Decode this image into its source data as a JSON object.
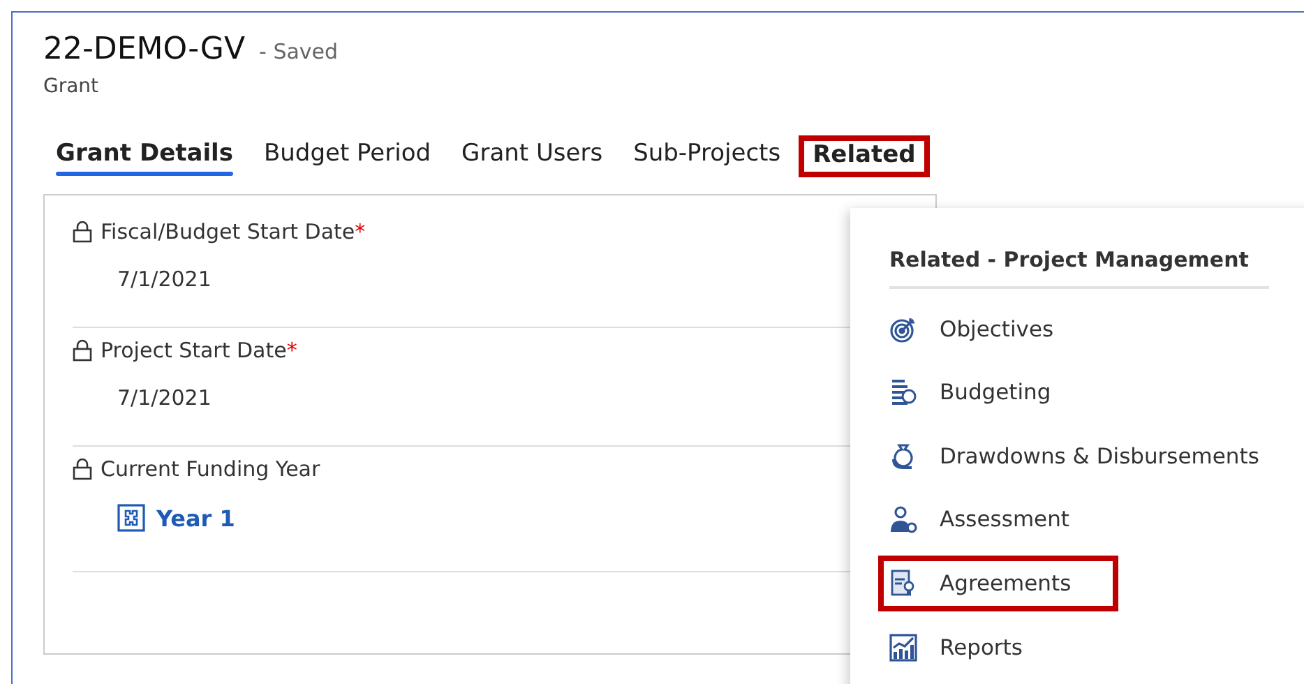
{
  "header": {
    "title": "22-DEMO-GV",
    "status": "- Saved",
    "entity": "Grant"
  },
  "tabs": [
    {
      "label": "Grant Details",
      "selected": true,
      "highlighted": false
    },
    {
      "label": "Budget Period",
      "selected": false,
      "highlighted": false
    },
    {
      "label": "Grant Users",
      "selected": false,
      "highlighted": false
    },
    {
      "label": "Sub-Projects",
      "selected": false,
      "highlighted": false
    },
    {
      "label": "Related",
      "selected": false,
      "highlighted": true
    }
  ],
  "fields": [
    {
      "label": "Fiscal/Budget Start Date",
      "required_mark": "*",
      "locked": true,
      "kind": "text",
      "value": "7/1/2021"
    },
    {
      "label": "Project Start Date",
      "required_mark": "*",
      "locked": true,
      "kind": "text",
      "value": "7/1/2021"
    },
    {
      "label": "Current Funding Year",
      "locked": true,
      "kind": "lookup",
      "value": "Year 1"
    }
  ],
  "related_menu": {
    "heading": "Related - Project Management",
    "items": [
      {
        "label": "Objectives",
        "kind": "target",
        "highlighted": false
      },
      {
        "label": "Budgeting",
        "kind": "ledger",
        "highlighted": false
      },
      {
        "label": "Drawdowns & Disbursements",
        "kind": "moneybag",
        "highlighted": false
      },
      {
        "label": "Assessment",
        "kind": "person",
        "highlighted": false
      },
      {
        "label": "Agreements",
        "kind": "certificate",
        "highlighted": true
      },
      {
        "label": "Reports",
        "kind": "chart",
        "highlighted": false
      }
    ]
  }
}
